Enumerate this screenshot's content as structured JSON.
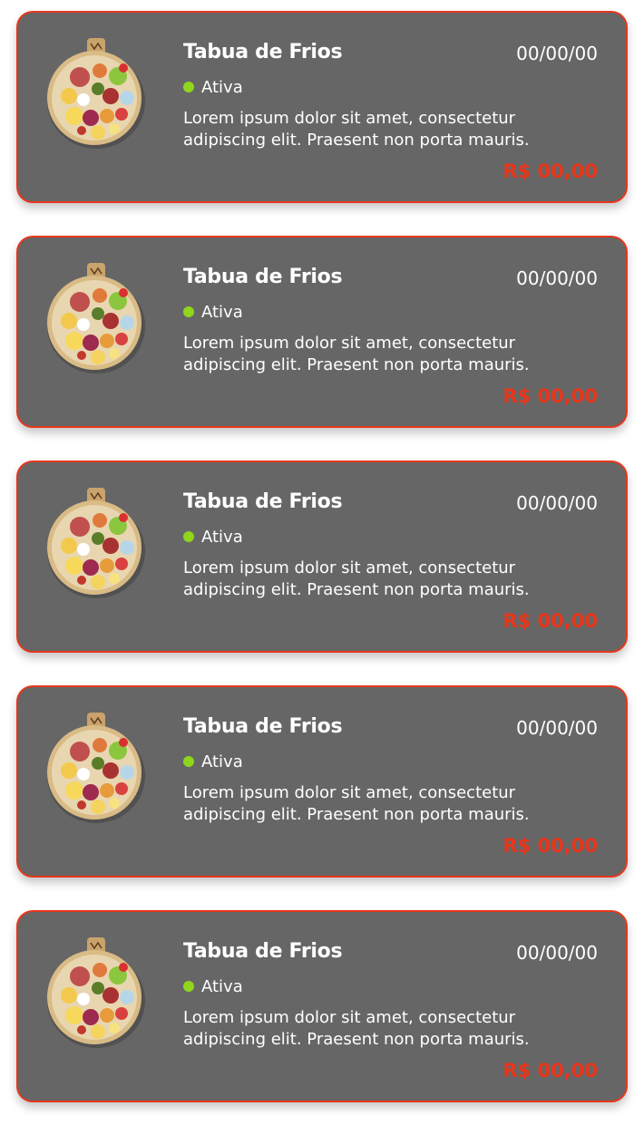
{
  "colors": {
    "card_background": "#666666",
    "card_border": "#e8361b",
    "price": "#e8361b",
    "status_active": "#8fd61c",
    "text": "#ffffff"
  },
  "items": [
    {
      "title": "Tabua de Frios",
      "date": "00/00/00",
      "status": "Ativa",
      "description_line1": "Lorem ipsum dolor sit amet, consectetur",
      "description_line2": "adipiscing elit. Praesent non porta mauris.",
      "price": "R$ 00,00",
      "image_icon": "charcuterie-board-image"
    },
    {
      "title": "Tabua de Frios",
      "date": "00/00/00",
      "status": "Ativa",
      "description_line1": "Lorem ipsum dolor sit amet, consectetur",
      "description_line2": "adipiscing elit. Praesent non porta mauris.",
      "price": "R$ 00,00",
      "image_icon": "charcuterie-board-image"
    },
    {
      "title": "Tabua de Frios",
      "date": "00/00/00",
      "status": "Ativa",
      "description_line1": "Lorem ipsum dolor sit amet, consectetur",
      "description_line2": "adipiscing elit. Praesent non porta mauris.",
      "price": "R$ 00,00",
      "image_icon": "charcuterie-board-image"
    },
    {
      "title": "Tabua de Frios",
      "date": "00/00/00",
      "status": "Ativa",
      "description_line1": "Lorem ipsum dolor sit amet, consectetur",
      "description_line2": "adipiscing elit. Praesent non porta mauris.",
      "price": "R$ 00,00",
      "image_icon": "charcuterie-board-image"
    },
    {
      "title": "Tabua de Frios",
      "date": "00/00/00",
      "status": "Ativa",
      "description_line1": "Lorem ipsum dolor sit amet, consectetur",
      "description_line2": "adipiscing elit. Praesent non porta mauris.",
      "price": "R$ 00,00",
      "image_icon": "charcuterie-board-image"
    }
  ]
}
